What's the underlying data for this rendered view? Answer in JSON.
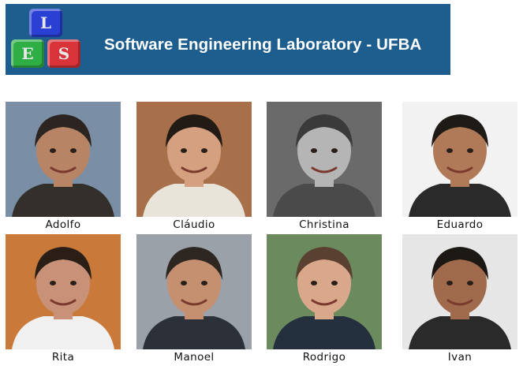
{
  "header": {
    "title": "Software Engineering Laboratory - UFBA",
    "logo_letters": {
      "top": "L",
      "left": "E",
      "right": "S"
    },
    "banner_color": "#1e5e8e"
  },
  "members": [
    {
      "name": "Adolfo",
      "bg": "#7a8fa6",
      "skin": "#b88466",
      "hair": "#2b2420",
      "shirt": "#33302c"
    },
    {
      "name": "Cláudio",
      "bg": "#a8704a",
      "skin": "#d5a07f",
      "hair": "#221a14",
      "shirt": "#e8e4da"
    },
    {
      "name": "Christina",
      "bg": "#6a6a6a",
      "skin": "#b5b5b5",
      "hair": "#3a3a3a",
      "shirt": "#4a4a4a"
    },
    {
      "name": "Eduardo",
      "bg": "#f2f2f2",
      "skin": "#b07a58",
      "hair": "#1e1a16",
      "shirt": "#2a2a2a"
    },
    {
      "name": "Rita",
      "bg": "#c97a3a",
      "skin": "#c99278",
      "hair": "#2a1e16",
      "shirt": "#f0f0f0"
    },
    {
      "name": "Manoel",
      "bg": "#9aa1a8",
      "skin": "#c49070",
      "hair": "#2e2620",
      "shirt": "#2c3038"
    },
    {
      "name": "Rodrigo",
      "bg": "#6b8a5e",
      "skin": "#d9a88a",
      "hair": "#5a4030",
      "shirt": "#24303e"
    },
    {
      "name": "Ivan",
      "bg": "#e6e6e6",
      "skin": "#a06a4c",
      "hair": "#1c1814",
      "shirt": "#2a2a2a"
    }
  ]
}
